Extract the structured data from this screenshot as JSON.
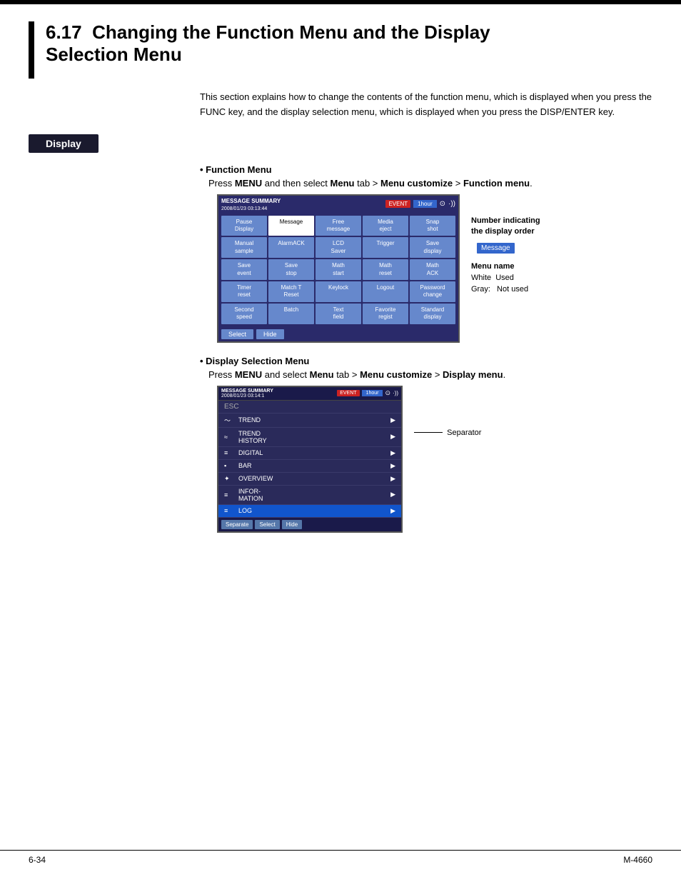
{
  "top_bar": {},
  "header": {
    "section_number": "6.17",
    "title": "Changing the Function Menu and the Display\nSelection Menu",
    "intro": "This section explains how to change the contents of the function menu, which is\ndisplayed when you press the FUNC key, and the display selection menu, which is\ndisplayed when you press the DISP/ENTER key."
  },
  "display_badge": "Display",
  "function_menu": {
    "bullet_title": "Function Menu",
    "instruction_text_pre": "Press ",
    "instruction_bold1": "MENU",
    "instruction_text_mid": " and then select ",
    "instruction_bold2": "Menu",
    "instruction_text_mid2": " tab > ",
    "instruction_bold3": "Menu customize",
    "instruction_text_end": " > ",
    "instruction_bold4": "Function menu",
    "screen": {
      "header_title": "MESSAGE SUMMARY",
      "header_date": "2008/01/23 03:13:44",
      "tab_event": "EVENT",
      "tab_1hour": "1hour",
      "cells": [
        {
          "label": "Pause\nDisplay",
          "type": "blue"
        },
        {
          "label": "Message",
          "type": "white"
        },
        {
          "label": "Free\nmessage",
          "type": "blue"
        },
        {
          "label": "Media\neject",
          "type": "blue"
        },
        {
          "label": "Snap\nshot",
          "type": "blue"
        },
        {
          "label": "Manual\nsample",
          "type": "blue"
        },
        {
          "label": "AlarmACK",
          "type": "blue"
        },
        {
          "label": "LCD\nSaver",
          "type": "blue"
        },
        {
          "label": "Trigger",
          "type": "blue"
        },
        {
          "label": "Save\ndisplay",
          "type": "blue"
        },
        {
          "label": "Save\nevent",
          "type": "blue"
        },
        {
          "label": "Save\nstop",
          "type": "blue"
        },
        {
          "label": "Math\nstart",
          "type": "blue"
        },
        {
          "label": "Math\nreset",
          "type": "blue"
        },
        {
          "label": "Math\nACK",
          "type": "blue"
        },
        {
          "label": "Timer\nreset",
          "type": "blue"
        },
        {
          "label": "Match T\nReset",
          "type": "blue"
        },
        {
          "label": "Keylock",
          "type": "blue"
        },
        {
          "label": "Logout",
          "type": "blue"
        },
        {
          "label": "Password\nchange",
          "type": "blue"
        },
        {
          "label": "Second\nspeed",
          "type": "blue"
        },
        {
          "label": "Batch",
          "type": "blue"
        },
        {
          "label": "Text\nfield",
          "type": "blue"
        },
        {
          "label": "Favorite\nregist",
          "type": "blue"
        },
        {
          "label": "Standard\ndisplay",
          "type": "blue"
        }
      ],
      "buttons": [
        "Select",
        "Hide"
      ]
    },
    "annotations": {
      "number_label": "Number indicating\nthe display order",
      "message_badge": "Message",
      "menu_name_label": "Menu name",
      "white_used": "White  Used",
      "gray_not_used": "Gray:   Not used"
    }
  },
  "display_menu": {
    "bullet_title": "Display Selection Menu",
    "instruction_text_pre": "Press ",
    "instruction_bold1": "MENU",
    "instruction_text_mid": " and select ",
    "instruction_bold2": "Menu",
    "instruction_text_mid2": " tab > ",
    "instruction_bold3": "Menu customize",
    "instruction_text_end": " > ",
    "instruction_bold4": "Display menu",
    "screen": {
      "header_title": "MESSAGE SUMMARY",
      "header_date": "2008/01/23 03:14:1",
      "tab_event": "EVENT",
      "tab_1hour": "1hour",
      "items": [
        {
          "label": "ESC",
          "type": "esc"
        },
        {
          "label": "TREND",
          "icon": "〜",
          "has_arrow": true,
          "selected": false
        },
        {
          "label": "TREND\nHISTORY",
          "icon": "≈",
          "has_arrow": true,
          "selected": false
        },
        {
          "label": "DIGITAL",
          "icon": "≡",
          "has_arrow": true,
          "selected": false
        },
        {
          "label": "BAR",
          "icon": "▪",
          "has_arrow": true,
          "selected": false
        },
        {
          "label": "OVERVIEW",
          "icon": "✦",
          "has_arrow": true,
          "selected": false
        },
        {
          "label": "INFOR-\nMATION",
          "icon": "≡",
          "has_arrow": true,
          "selected": false
        },
        {
          "label": "LOG",
          "icon": "≡",
          "has_arrow": true,
          "selected": true
        }
      ],
      "buttons": [
        "Separate",
        "Select",
        "Hide"
      ]
    },
    "separator_label": "Separator"
  },
  "footer": {
    "page_number": "6-34",
    "model": "M-4660"
  }
}
